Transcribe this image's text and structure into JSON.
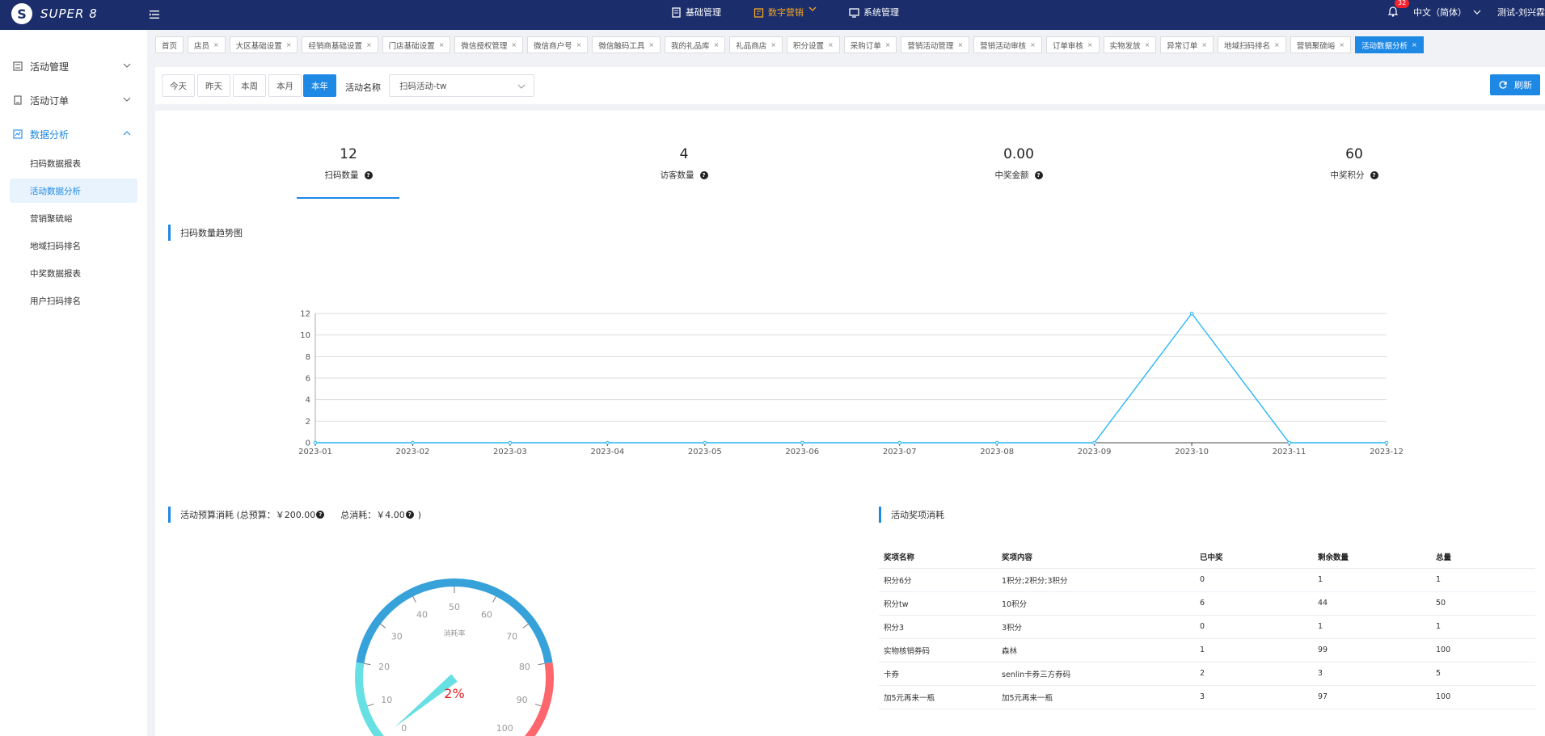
{
  "app": {
    "logo_letter": "S",
    "logo_text": "SUPER 8"
  },
  "topnav": [
    {
      "label": "基础管理",
      "active": false
    },
    {
      "label": "数字营销",
      "active": true
    },
    {
      "label": "系统管理",
      "active": false
    }
  ],
  "header": {
    "notification_count": "32",
    "language": "中文（简体）",
    "user": "测试-刘兴霖"
  },
  "sidebar": {
    "groups": [
      {
        "label": "活动管理",
        "open": false
      },
      {
        "label": "活动订单",
        "open": false
      },
      {
        "label": "数据分析",
        "open": true
      }
    ],
    "subitems": [
      {
        "label": "扫码数据报表",
        "active": false
      },
      {
        "label": "活动数据分析",
        "active": true
      },
      {
        "label": "营销聚硫峪",
        "active": false
      },
      {
        "label": "地域扫码排名",
        "active": false
      },
      {
        "label": "中奖数据报表",
        "active": false
      },
      {
        "label": "用户扫码排名",
        "active": false
      }
    ]
  },
  "tabs": [
    {
      "label": "首页",
      "closable": false
    },
    {
      "label": "店员",
      "closable": true
    },
    {
      "label": "大区基础设置",
      "closable": true
    },
    {
      "label": "经销商基础设置",
      "closable": true
    },
    {
      "label": "门店基础设置",
      "closable": true
    },
    {
      "label": "微信授权管理",
      "closable": true
    },
    {
      "label": "微信商户号",
      "closable": true
    },
    {
      "label": "微信触码工具",
      "closable": true
    },
    {
      "label": "我的礼品库",
      "closable": true
    },
    {
      "label": "礼品商店",
      "closable": true
    },
    {
      "label": "积分设置",
      "closable": true
    },
    {
      "label": "采购订单",
      "closable": true
    },
    {
      "label": "营销活动管理",
      "closable": true
    },
    {
      "label": "营销活动审核",
      "closable": true
    },
    {
      "label": "订单审核",
      "closable": true
    },
    {
      "label": "实物发放",
      "closable": true
    },
    {
      "label": "异常订单",
      "closable": true
    },
    {
      "label": "地域扫码排名",
      "closable": true
    },
    {
      "label": "营销聚硫峪",
      "closable": true
    },
    {
      "label": "活动数据分析",
      "closable": true,
      "active": true
    }
  ],
  "filter": {
    "buttons": [
      "今天",
      "昨天",
      "本周",
      "本月",
      "本年"
    ],
    "active_button": "本年",
    "activity_label": "活动名称",
    "activity_value": "扫码活动-tw",
    "refresh_label": "刷新"
  },
  "stats": [
    {
      "value": "12",
      "label": "扫码数量"
    },
    {
      "value": "4",
      "label": "访客数量"
    },
    {
      "value": "0.00",
      "label": "中奖金额"
    },
    {
      "value": "60",
      "label": "中奖积分"
    }
  ],
  "trend_title": "扫码数量趋势图",
  "budget_title": "活动预算消耗 (总预算：￥200.00",
  "budget_total_consumed": "总消耗：￥4.00",
  "budget_close_paren": ")",
  "prize_title": "活动奖项消耗",
  "chart_data": [
    {
      "type": "line",
      "x": [
        "2023-01",
        "2023-02",
        "2023-03",
        "2023-04",
        "2023-05",
        "2023-06",
        "2023-07",
        "2023-08",
        "2023-09",
        "2023-10",
        "2023-11",
        "2023-12"
      ],
      "values": [
        0,
        0,
        0,
        0,
        0,
        0,
        0,
        0,
        0,
        12,
        0,
        0
      ],
      "ylim": [
        0,
        12
      ],
      "yticks": [
        0,
        2,
        4,
        6,
        8,
        10,
        12
      ],
      "grid": true,
      "color": "#29b6f6"
    },
    {
      "type": "gauge",
      "value": 2,
      "value_label": "2%",
      "center_label": "消耗率",
      "range": [
        0,
        100
      ],
      "ticks": [
        "0",
        "10",
        "20",
        "30",
        "40",
        "50",
        "60",
        "70",
        "80",
        "90",
        "100"
      ],
      "colors": {
        "low": "#67e0e3",
        "mid": "#37a2da",
        "high": "#fd666d",
        "value": "#e02020"
      }
    }
  ],
  "prize_table": {
    "headers": [
      "奖项名称",
      "奖项内容",
      "已中奖",
      "剩余数量",
      "总量"
    ],
    "rows": [
      [
        "积分6分",
        "1积分;2积分;3积分",
        "0",
        "1",
        "1"
      ],
      [
        "积分tw",
        "10积分",
        "6",
        "44",
        "50"
      ],
      [
        "积分3",
        "3积分",
        "0",
        "1",
        "1"
      ],
      [
        "实物核销券码",
        "森林",
        "1",
        "99",
        "100"
      ],
      [
        "卡券",
        "senlin卡券三方券码",
        "2",
        "3",
        "5"
      ],
      [
        "加5元再来一瓶",
        "加5元再来一瓶",
        "3",
        "97",
        "100"
      ]
    ]
  }
}
